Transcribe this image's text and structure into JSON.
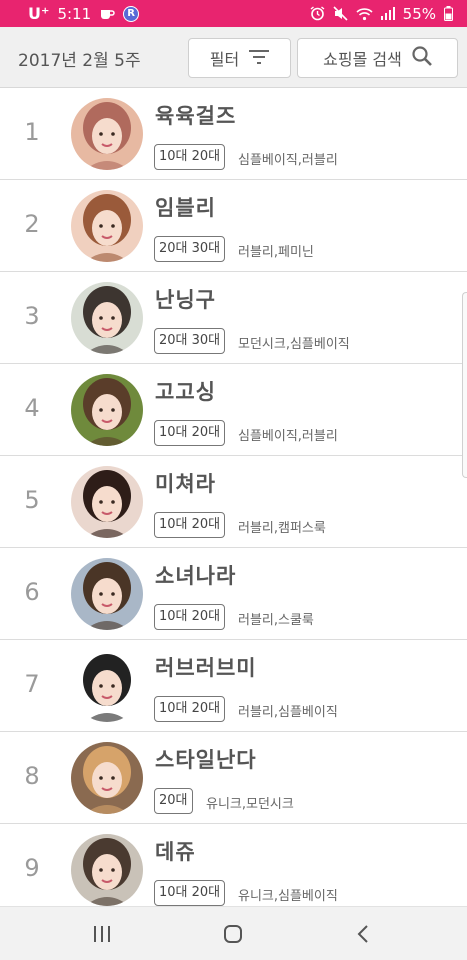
{
  "status_bar": {
    "carrier": "U⁺",
    "time": "5:11",
    "badge": "R",
    "battery": "55%"
  },
  "header": {
    "week": "2017년 2월 5주",
    "filter_label": "필터",
    "search_label": "쇼핑몰 검색"
  },
  "shops": [
    {
      "rank": "1",
      "name": "육육걸즈",
      "age": "10대 20대",
      "style": "심플베이직,러블리",
      "avatar_bg": "#e7b9a2",
      "hair": "#b06a5d"
    },
    {
      "rank": "2",
      "name": "임블리",
      "age": "20대 30대",
      "style": "러블리,페미닌",
      "avatar_bg": "#f0d0bf",
      "hair": "#9a5a3a"
    },
    {
      "rank": "3",
      "name": "난닝구",
      "age": "20대 30대",
      "style": "모던시크,심플베이직",
      "avatar_bg": "#d8ddd4",
      "hair": "#3d3530"
    },
    {
      "rank": "4",
      "name": "고고싱",
      "age": "10대 20대",
      "style": "심플베이직,러블리",
      "avatar_bg": "#6f8a3c",
      "hair": "#5a3d2a"
    },
    {
      "rank": "5",
      "name": "미쳐라",
      "age": "10대 20대",
      "style": "러블리,캠퍼스룩",
      "avatar_bg": "#ead7ce",
      "hair": "#2e1d18"
    },
    {
      "rank": "6",
      "name": "소녀나라",
      "age": "10대 20대",
      "style": "러블리,스쿨룩",
      "avatar_bg": "#a9b7c7",
      "hair": "#4a3526"
    },
    {
      "rank": "7",
      "name": "러브러브미",
      "age": "10대 20대",
      "style": "러블리,심플베이직",
      "avatar_bg": "#ffffff",
      "hair": "#222222"
    },
    {
      "rank": "8",
      "name": "스타일난다",
      "age": "20대",
      "style": "유니크,모던시크",
      "avatar_bg": "#8a6a50",
      "hair": "#d6a36a"
    },
    {
      "rank": "9",
      "name": "데쥬",
      "age": "10대 20대",
      "style": "유니크,심플베이직",
      "avatar_bg": "#c9c2b8",
      "hair": "#4a3a30"
    }
  ],
  "colors": {
    "status_bar": "#e8246f",
    "header_bg": "#f0f0f0",
    "rank_text": "#9a9a9a"
  },
  "icons": {
    "filter": "filter-lines-icon",
    "search": "magnifier-icon",
    "nav_recent": "recent-apps-icon",
    "nav_home": "home-icon",
    "nav_back": "back-icon"
  }
}
